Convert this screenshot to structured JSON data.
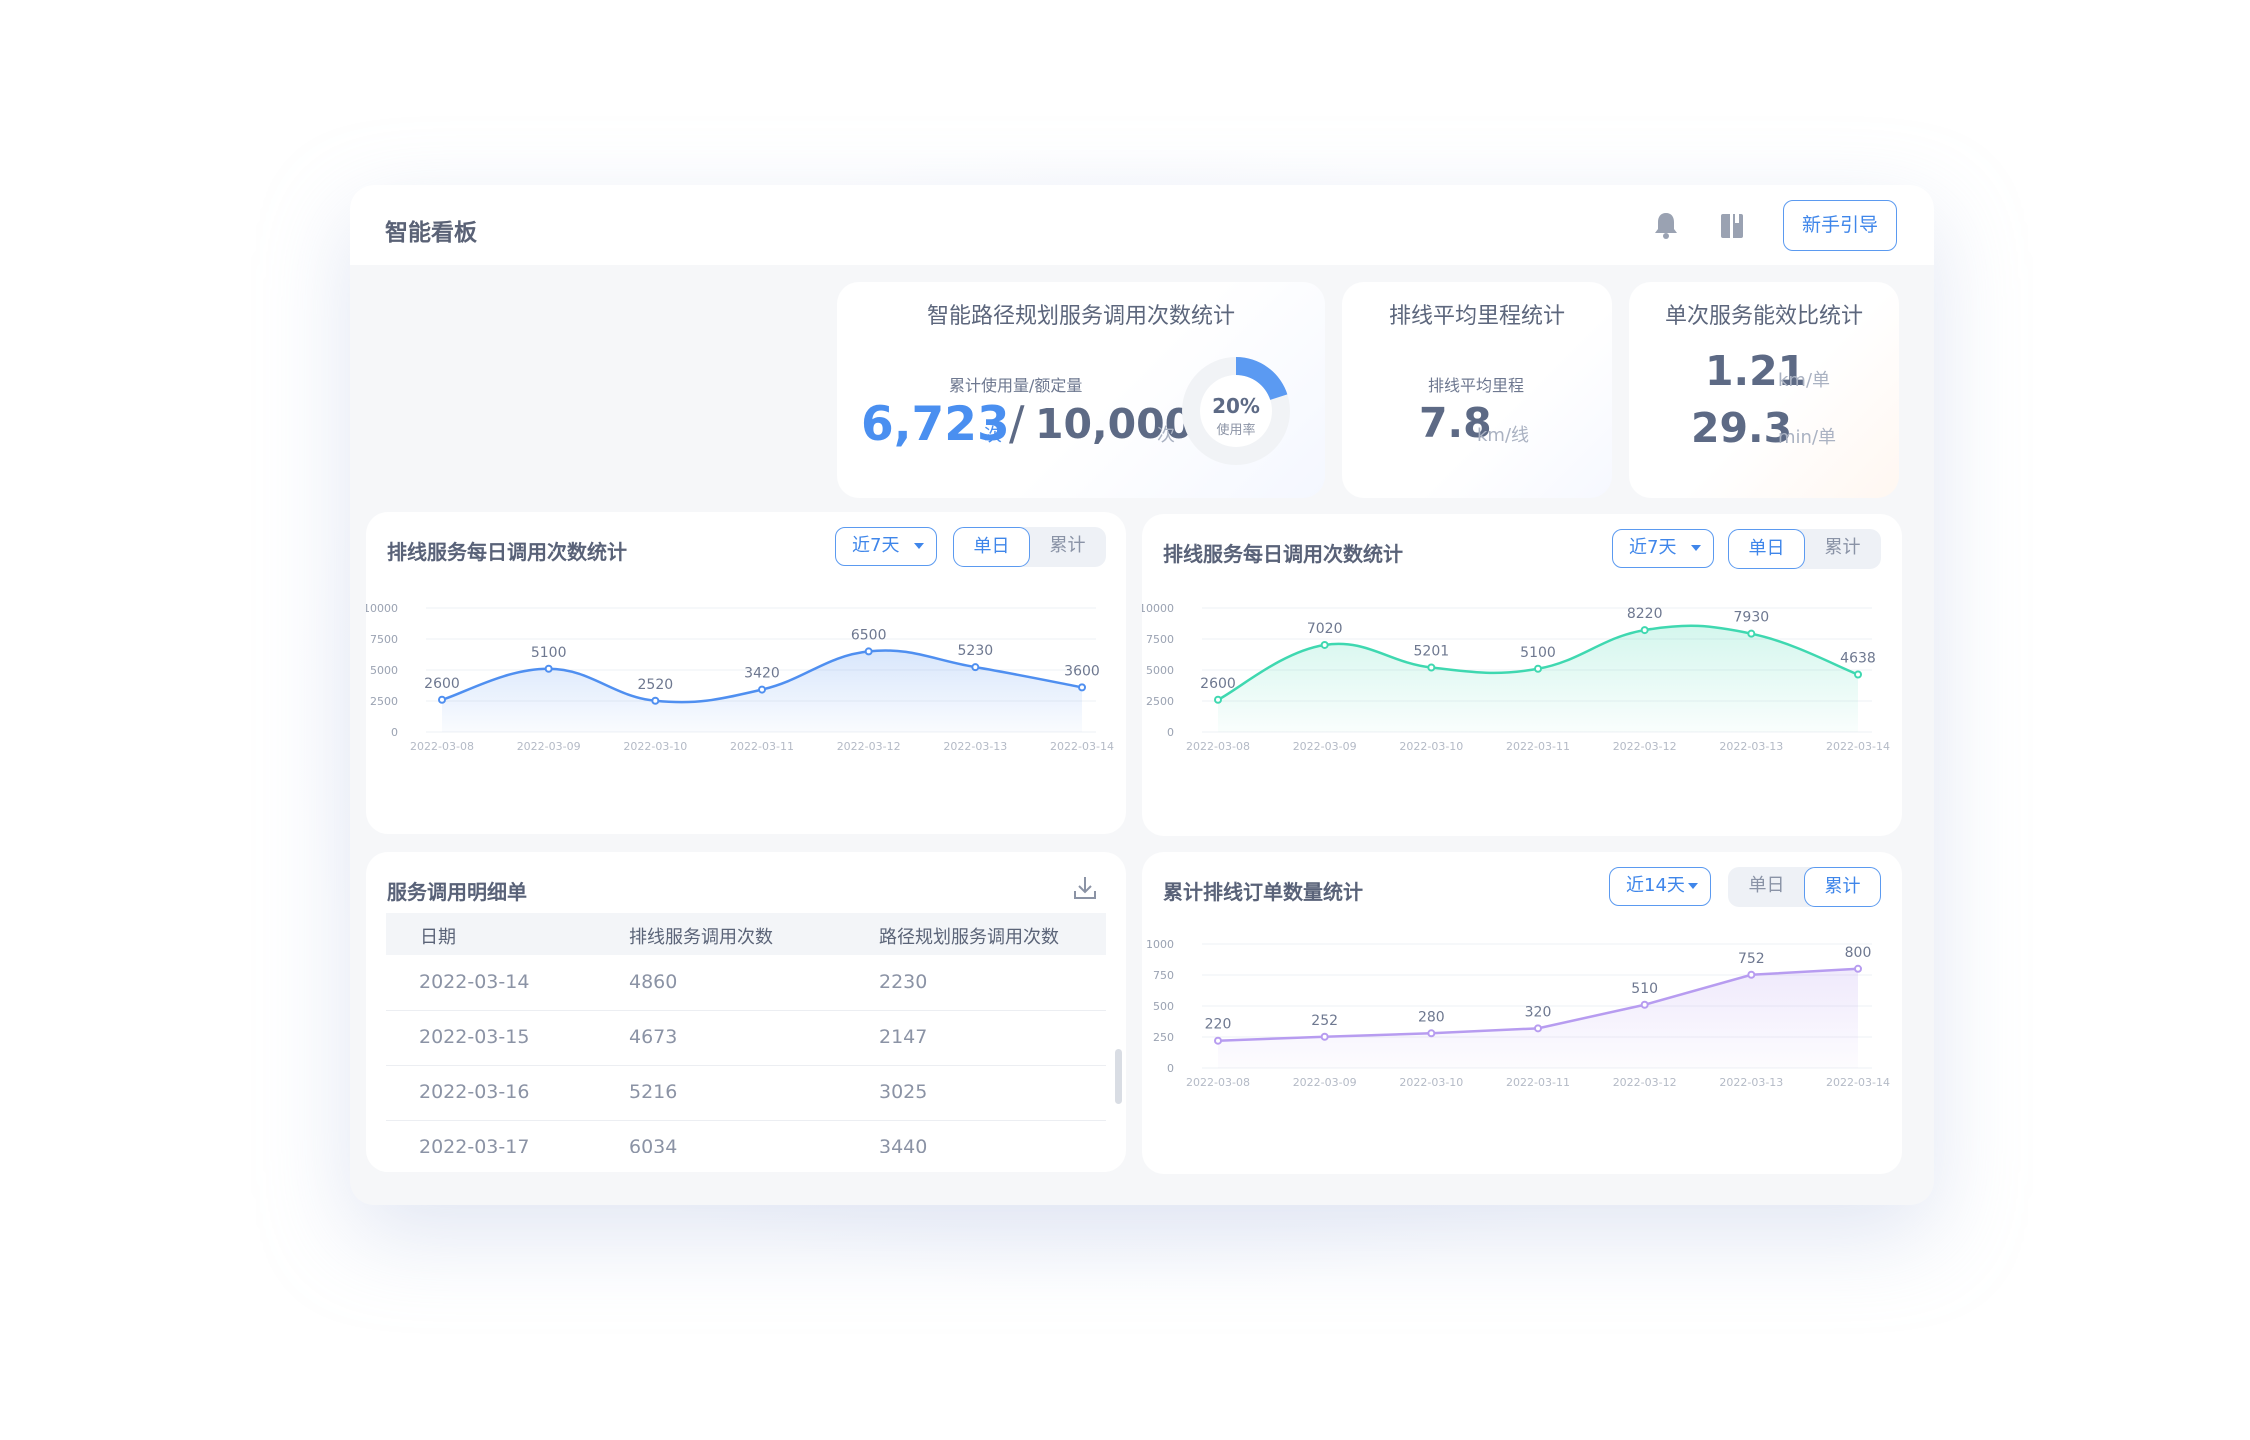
{
  "app": {
    "title": "智能看板",
    "guide_label": "新手引导"
  },
  "stats": {
    "route_calls": {
      "title": "智能路径规划服务调用次数统计",
      "label": "累计使用量/额定量",
      "used": "6,723",
      "used_unit": "次",
      "separator": "/",
      "quota": "10,000",
      "quota_unit": "次",
      "rate_text": "20%",
      "rate_label": "使用率",
      "rate_fraction": 0.2
    },
    "avg_mileage": {
      "title": "排线平均里程统计",
      "label": "排线平均里程",
      "value": "7.8",
      "unit": "km/线"
    },
    "efficiency": {
      "title": "单次服务能效比统计",
      "value1": "1.21",
      "unit1": "km/单",
      "value2": "29.3",
      "unit2": "min/单"
    }
  },
  "panels": {
    "daily_left": {
      "title": "排线服务每日调用次数统计",
      "range": "近7天",
      "seg1": "单日",
      "seg2": "累计"
    },
    "daily_right": {
      "title": "排线服务每日调用次数统计",
      "range": "近7天",
      "seg1": "单日",
      "seg2": "累计"
    },
    "detail": {
      "title": "服务调用明细单",
      "columns": [
        "日期",
        "排线服务调用次数",
        "路径规划服务调用次数"
      ],
      "rows": [
        [
          "2022-03-14",
          "4860",
          "2230"
        ],
        [
          "2022-03-15",
          "4673",
          "2147"
        ],
        [
          "2022-03-16",
          "5216",
          "3025"
        ],
        [
          "2022-03-17",
          "6034",
          "3440"
        ]
      ]
    },
    "cumulative": {
      "title": "累计排线订单数量统计",
      "range": "近14天",
      "seg1": "单日",
      "seg2": "累计"
    }
  },
  "colors": {
    "accent": "#3f86ea",
    "blue_line": "#4f8ff0",
    "green_line": "#3fd8b0",
    "purple_line": "#b79cf0"
  },
  "chart_data": [
    {
      "type": "line",
      "categories": [
        "2022-03-08",
        "2022-03-09",
        "2022-03-10",
        "2022-03-11",
        "2022-03-12",
        "2022-03-13",
        "2022-03-14"
      ],
      "series": [
        {
          "values": [
            2600,
            5100,
            2520,
            3420,
            6500,
            5230,
            3600
          ]
        }
      ],
      "yticks": [
        "0",
        "2500",
        "5000",
        "7500",
        "10000"
      ],
      "ylim": [
        0,
        10000
      ],
      "color": "#4f8ff0"
    },
    {
      "type": "line",
      "categories": [
        "2022-03-08",
        "2022-03-09",
        "2022-03-10",
        "2022-03-11",
        "2022-03-12",
        "2022-03-13",
        "2022-03-14"
      ],
      "series": [
        {
          "values": [
            2600,
            7020,
            5201,
            5100,
            8220,
            7930,
            4638
          ]
        }
      ],
      "yticks": [
        "0",
        "2500",
        "5000",
        "7500",
        "10000"
      ],
      "ylim": [
        0,
        10000
      ],
      "color": "#3fd8b0"
    },
    {
      "type": "area",
      "categories": [
        "2022-03-08",
        "2022-03-09",
        "2022-03-10",
        "2022-03-11",
        "2022-03-12",
        "2022-03-13",
        "2022-03-14"
      ],
      "series": [
        {
          "values": [
            220,
            252,
            280,
            320,
            510,
            752,
            800
          ]
        }
      ],
      "yticks": [
        "0",
        "250",
        "500",
        "750",
        "1000"
      ],
      "ylim": [
        0,
        1000
      ],
      "color": "#b79cf0"
    }
  ]
}
